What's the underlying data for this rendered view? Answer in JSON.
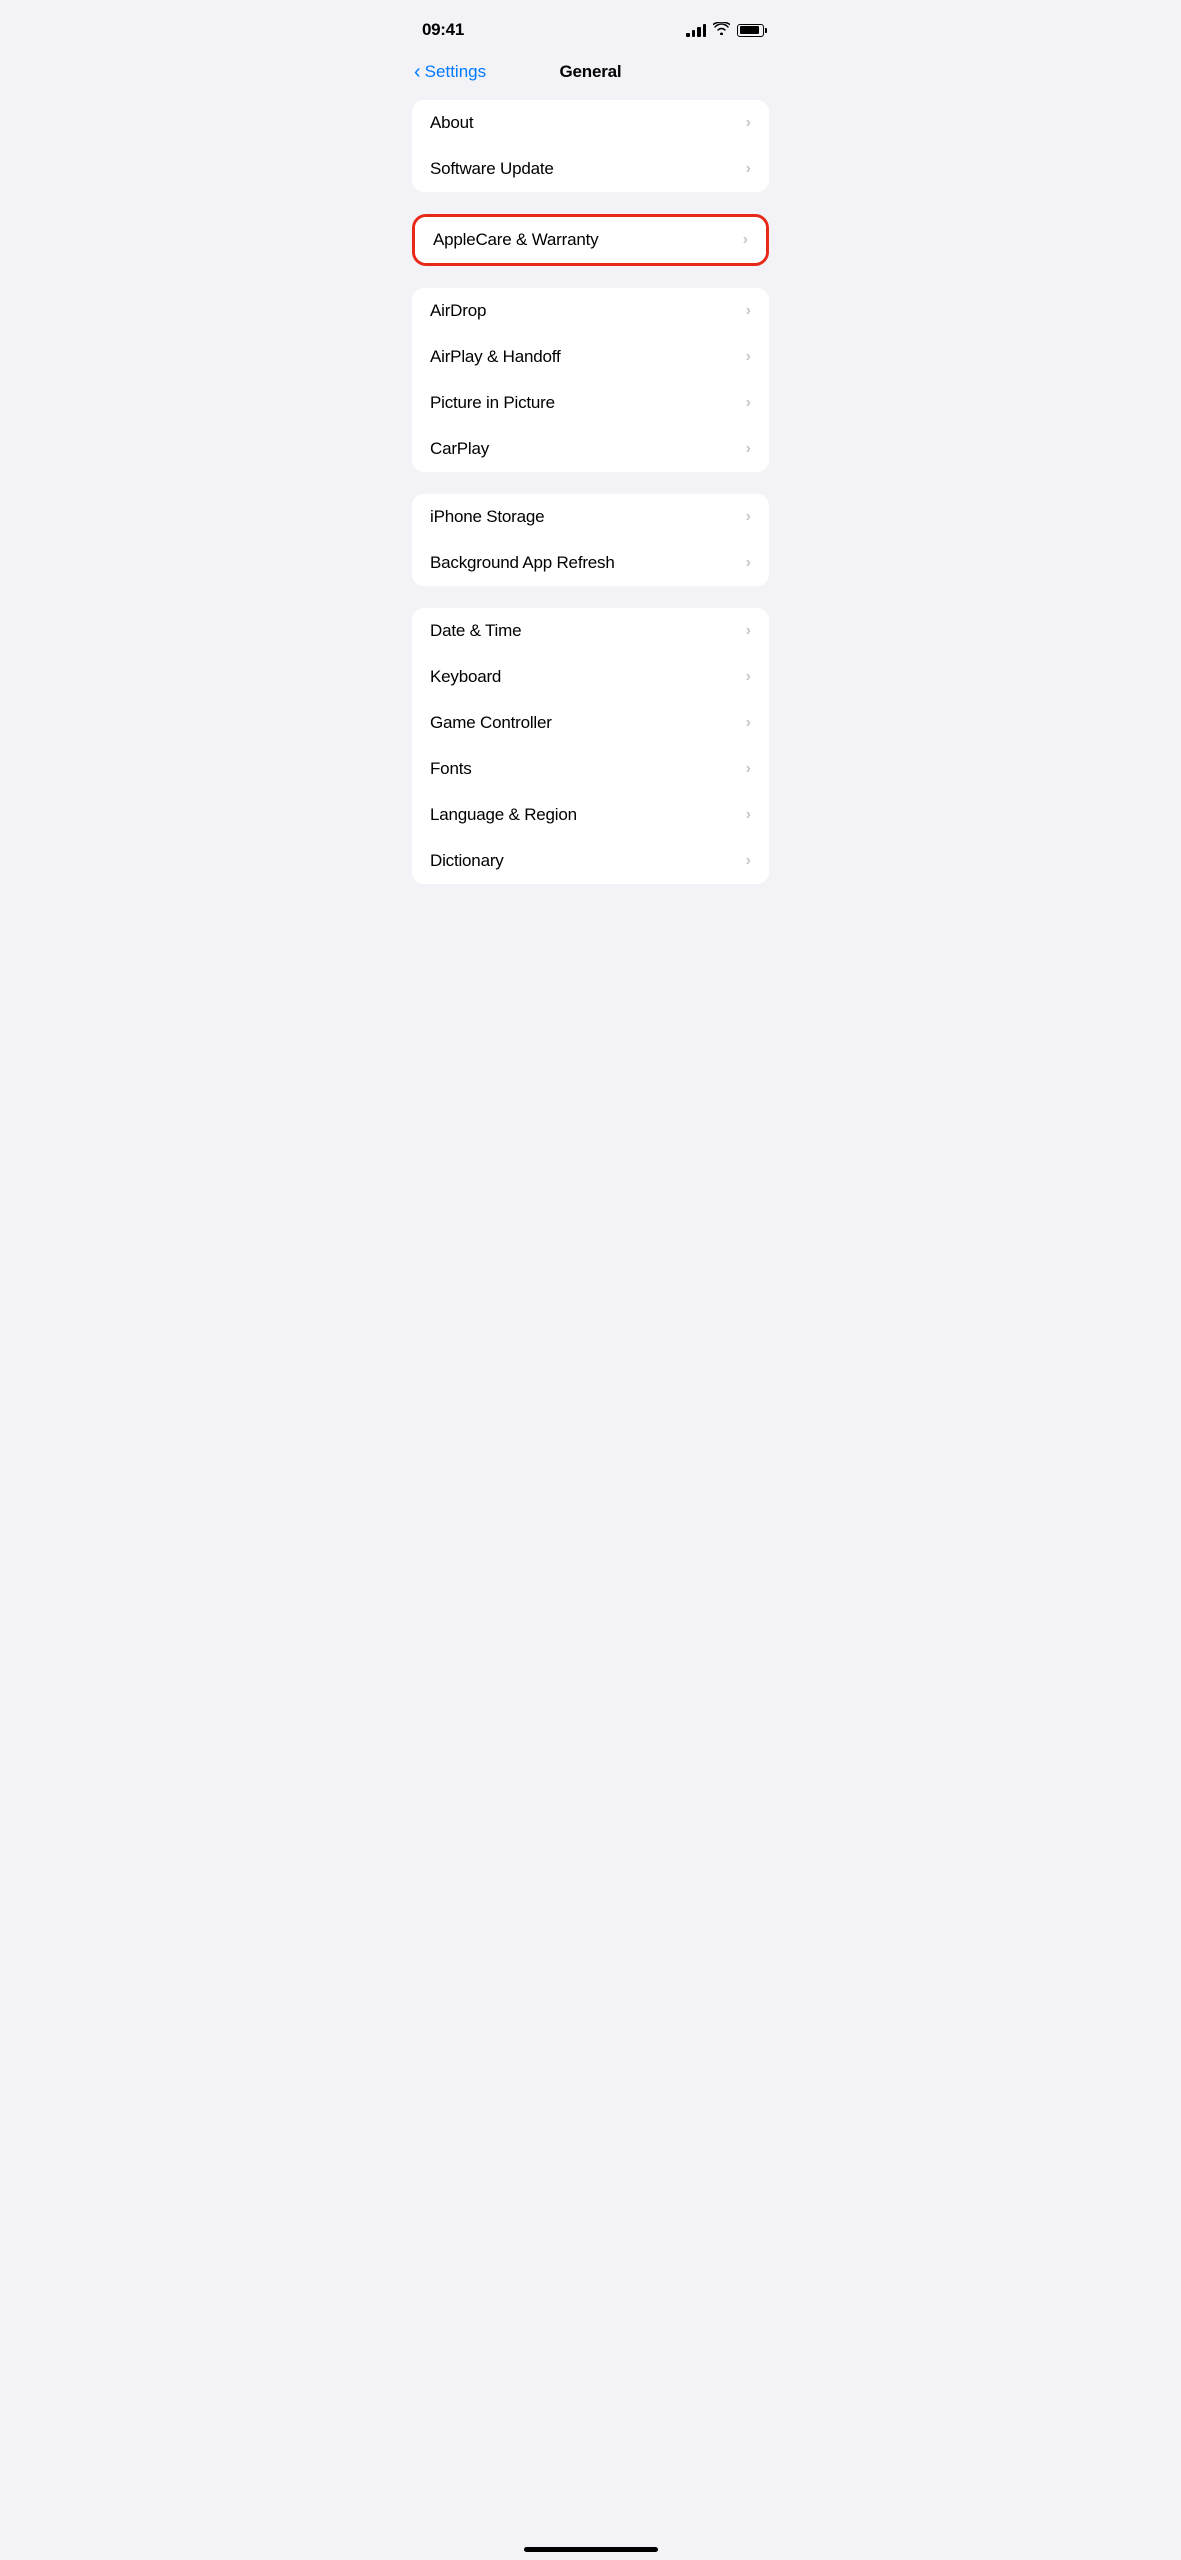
{
  "statusBar": {
    "time": "09:41",
    "batteryLevel": 90
  },
  "header": {
    "backLabel": "Settings",
    "title": "General"
  },
  "sections": [
    {
      "id": "section-1",
      "highlighted": false,
      "items": [
        {
          "id": "about",
          "label": "About"
        },
        {
          "id": "software-update",
          "label": "Software Update"
        }
      ]
    },
    {
      "id": "section-applecare",
      "highlighted": true,
      "items": [
        {
          "id": "applecare-warranty",
          "label": "AppleCare & Warranty"
        }
      ]
    },
    {
      "id": "section-2",
      "highlighted": false,
      "items": [
        {
          "id": "airdrop",
          "label": "AirDrop"
        },
        {
          "id": "airplay-handoff",
          "label": "AirPlay & Handoff"
        },
        {
          "id": "picture-in-picture",
          "label": "Picture in Picture"
        },
        {
          "id": "carplay",
          "label": "CarPlay"
        }
      ]
    },
    {
      "id": "section-3",
      "highlighted": false,
      "items": [
        {
          "id": "iphone-storage",
          "label": "iPhone Storage"
        },
        {
          "id": "background-app-refresh",
          "label": "Background App Refresh"
        }
      ]
    },
    {
      "id": "section-4",
      "highlighted": false,
      "items": [
        {
          "id": "date-time",
          "label": "Date & Time"
        },
        {
          "id": "keyboard",
          "label": "Keyboard"
        },
        {
          "id": "game-controller",
          "label": "Game Controller"
        },
        {
          "id": "fonts",
          "label": "Fonts"
        },
        {
          "id": "language-region",
          "label": "Language & Region"
        },
        {
          "id": "dictionary",
          "label": "Dictionary"
        }
      ]
    }
  ],
  "chevron": "›"
}
